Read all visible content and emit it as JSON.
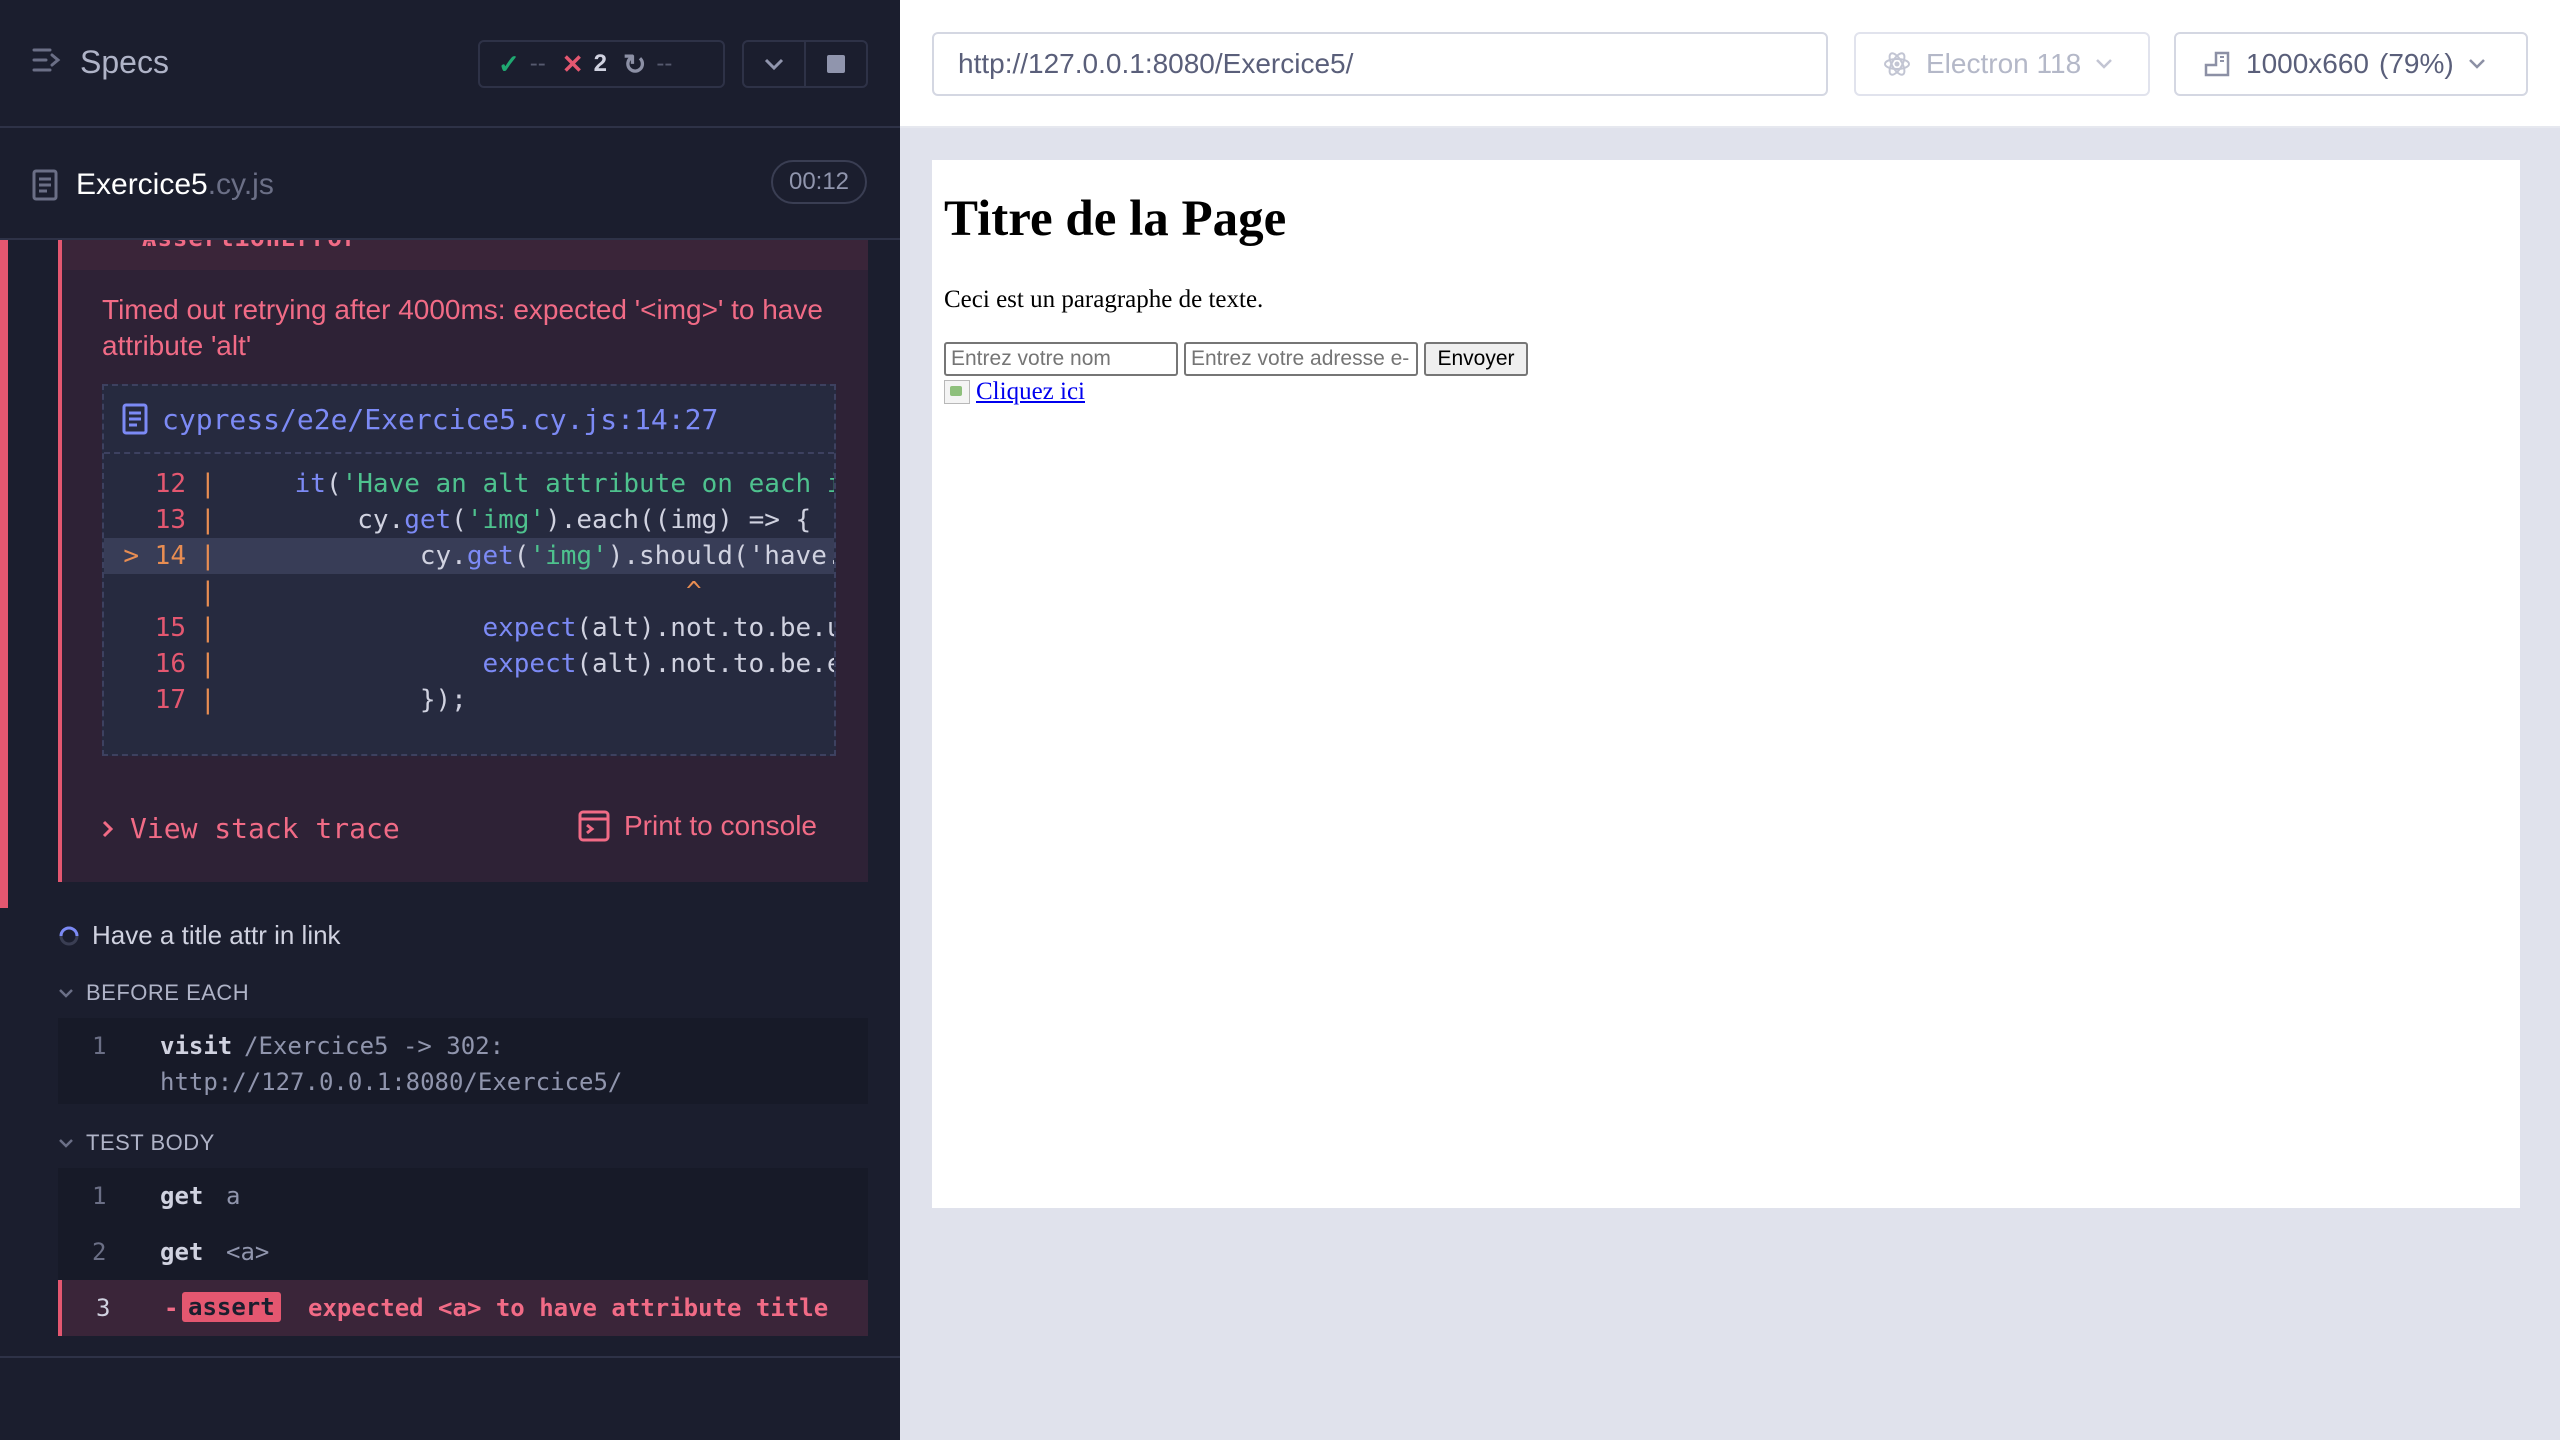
{
  "reporter": {
    "header": {
      "title": "Specs",
      "stats": {
        "passed": "--",
        "failed": "2",
        "pending": "--"
      }
    },
    "spec": {
      "name": "Exercice5",
      "ext": ".cy.js",
      "duration": "00:12"
    },
    "error": {
      "type": "AssertionError",
      "message": "Timed out retrying after 4000ms: expected '<img>' to have attribute 'alt'",
      "file_path": "cypress/e2e/Exercice5.cy.js:14:27",
      "view_stack_trace": "View stack trace",
      "print_to_console": "Print to console",
      "code_lines": [
        {
          "num": "12",
          "prefix": "",
          "code_pre": "    ",
          "kw": "it",
          "rest": "(",
          "str": "'Have an alt attribute on each i",
          "tail": ""
        },
        {
          "num": "13",
          "prefix": "",
          "code_pre": "        cy.",
          "kw": "get",
          "rest": "(",
          "str": "'img'",
          "tail": ").each((img) => {"
        },
        {
          "num": "14",
          "prefix": ">",
          "code_pre": "            cy.",
          "kw": "get",
          "rest": "(",
          "str": "'img'",
          "tail": ").should('have."
        },
        {
          "num": "",
          "prefix": "",
          "code_pre": "                             ",
          "kw": "",
          "rest": "",
          "str": "",
          "tail": "^"
        },
        {
          "num": "15",
          "prefix": "",
          "code_pre": "                ",
          "kw": "expect",
          "rest": "(alt).not.to.be.u",
          "str": "",
          "tail": ""
        },
        {
          "num": "16",
          "prefix": "",
          "code_pre": "                ",
          "kw": "expect",
          "rest": "(alt).not.to.be.e",
          "str": "",
          "tail": ""
        },
        {
          "num": "17",
          "prefix": "",
          "code_pre": "            });",
          "kw": "",
          "rest": "",
          "str": "",
          "tail": ""
        }
      ]
    },
    "test": {
      "title": "Have a title attr in link",
      "before_each": {
        "label": "BEFORE EACH",
        "commands": [
          {
            "num": "1",
            "name": "visit",
            "message": "/Exercice5 -> 302:",
            "message2": "http://127.0.0.1:8080/Exercice5/"
          }
        ]
      },
      "test_body": {
        "label": "TEST BODY",
        "commands": [
          {
            "num": "1",
            "name": "get",
            "message": "a"
          },
          {
            "num": "2",
            "name": "get",
            "message": "<a>"
          },
          {
            "num": "3",
            "name": "-assert",
            "badge": "assert",
            "message": "expected <a> to have attribute title"
          }
        ]
      }
    }
  },
  "aut": {
    "url": "http://127.0.0.1:8080/Exercice5/",
    "browser": "Electron 118",
    "viewport": "1000x660",
    "zoom": "(79%)",
    "page": {
      "heading": "Titre de la Page",
      "paragraph": "Ceci est un paragraphe de texte.",
      "name_placeholder": "Entrez votre nom",
      "email_placeholder": "Entrez votre adresse e-",
      "submit_label": "Envoyer",
      "link_text": "Cliquez ici"
    }
  },
  "colors": {
    "fail": "#e45770",
    "pass": "#1fa971",
    "accent": "#7c8af5",
    "reporter_bg": "#1b1e2e"
  }
}
